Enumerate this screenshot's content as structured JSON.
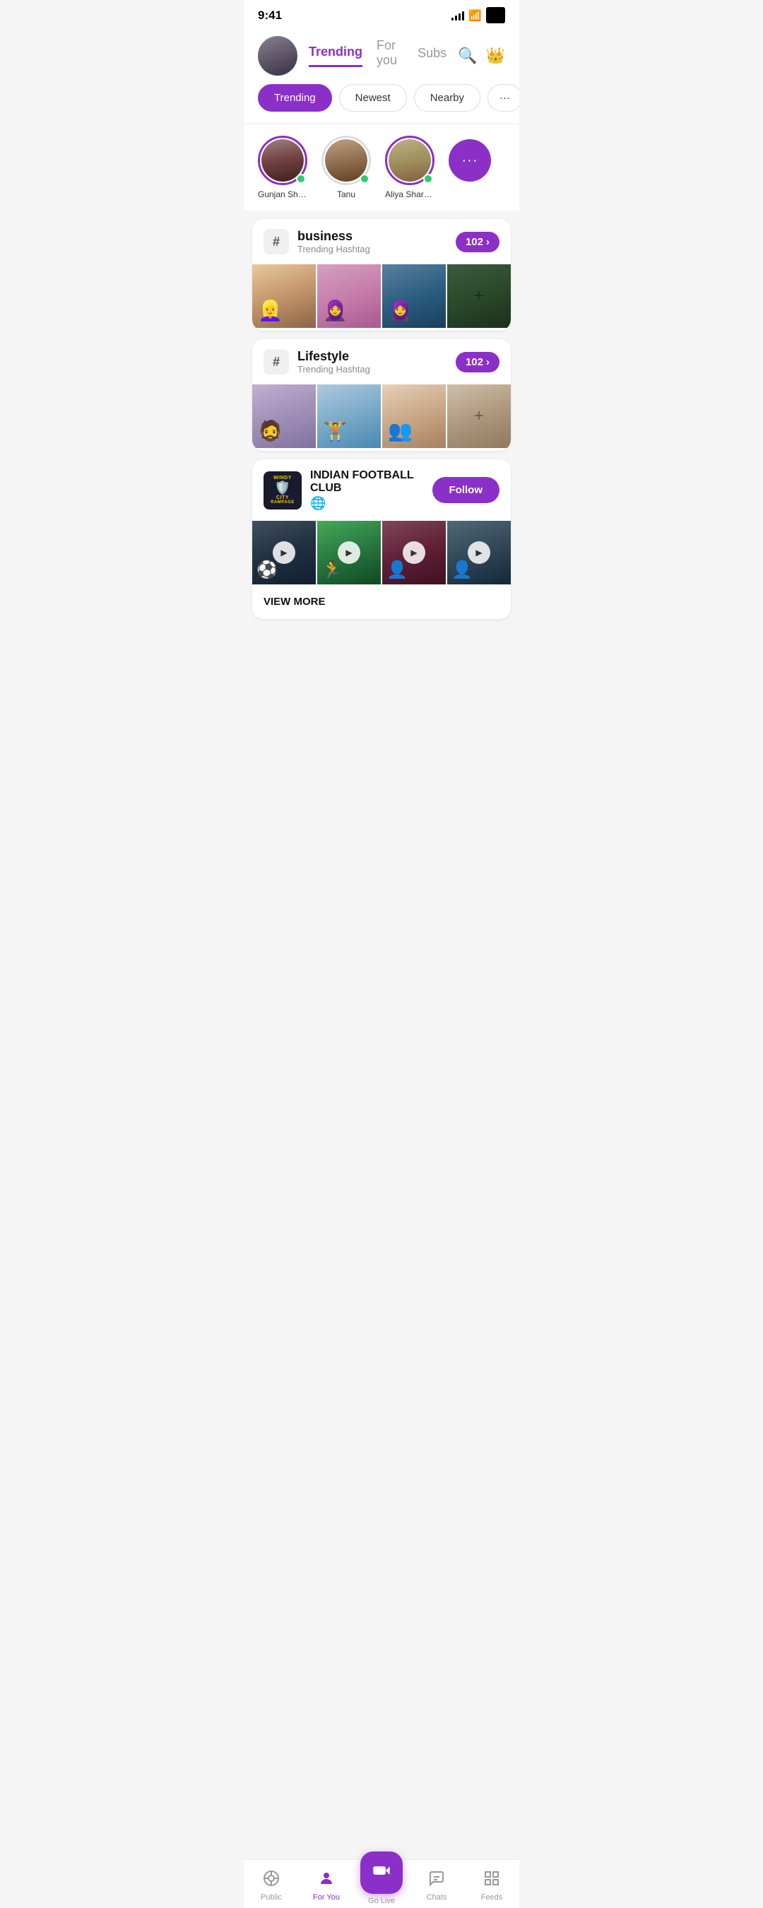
{
  "status": {
    "time": "9:41",
    "signal": 4,
    "wifi": true,
    "battery": "full"
  },
  "header": {
    "tabs": [
      {
        "label": "Trending",
        "active": true
      },
      {
        "label": "For you",
        "active": false
      },
      {
        "label": "Subs",
        "active": false
      }
    ]
  },
  "filters": [
    {
      "label": "Trending",
      "active": true
    },
    {
      "label": "Newest",
      "active": false
    },
    {
      "label": "Nearby",
      "active": false
    }
  ],
  "stories": [
    {
      "name": "Gunjan Sharma",
      "online": true,
      "hasBorder": true
    },
    {
      "name": "Tanu",
      "online": true,
      "hasBorder": false
    },
    {
      "name": "Aliya Sharma",
      "online": true,
      "hasBorder": true
    }
  ],
  "hashtags": [
    {
      "name": "business",
      "subtitle": "Trending Hashtag",
      "count": "102",
      "images": [
        "img-1",
        "img-2",
        "img-3",
        "img-4"
      ]
    },
    {
      "name": "Lifestyle",
      "subtitle": "Trending Hashtag",
      "count": "102",
      "images": [
        "img-lifestyle-1",
        "img-lifestyle-2",
        "img-lifestyle-3",
        "img-lifestyle-4"
      ]
    }
  ],
  "club": {
    "name": "INDIAN FOOTBALL CLUB",
    "logo_top": "WINDY city",
    "logo_bottom": "RAMPAGE",
    "follow_label": "Follow",
    "view_more_label": "VIEW MORE",
    "globe": "🌐",
    "videos": [
      "img-football-1",
      "img-football-2",
      "img-football-3",
      "img-football-4"
    ]
  },
  "bottomNav": {
    "items": [
      {
        "label": "Public",
        "icon": "📡",
        "active": false
      },
      {
        "label": "For You",
        "icon": "👤",
        "active": true
      },
      {
        "label": "Go Live",
        "icon": "🎥",
        "active": false,
        "center": true
      },
      {
        "label": "Chats",
        "icon": "💬",
        "active": false
      },
      {
        "label": "Feeds",
        "icon": "📋",
        "active": false
      }
    ]
  }
}
